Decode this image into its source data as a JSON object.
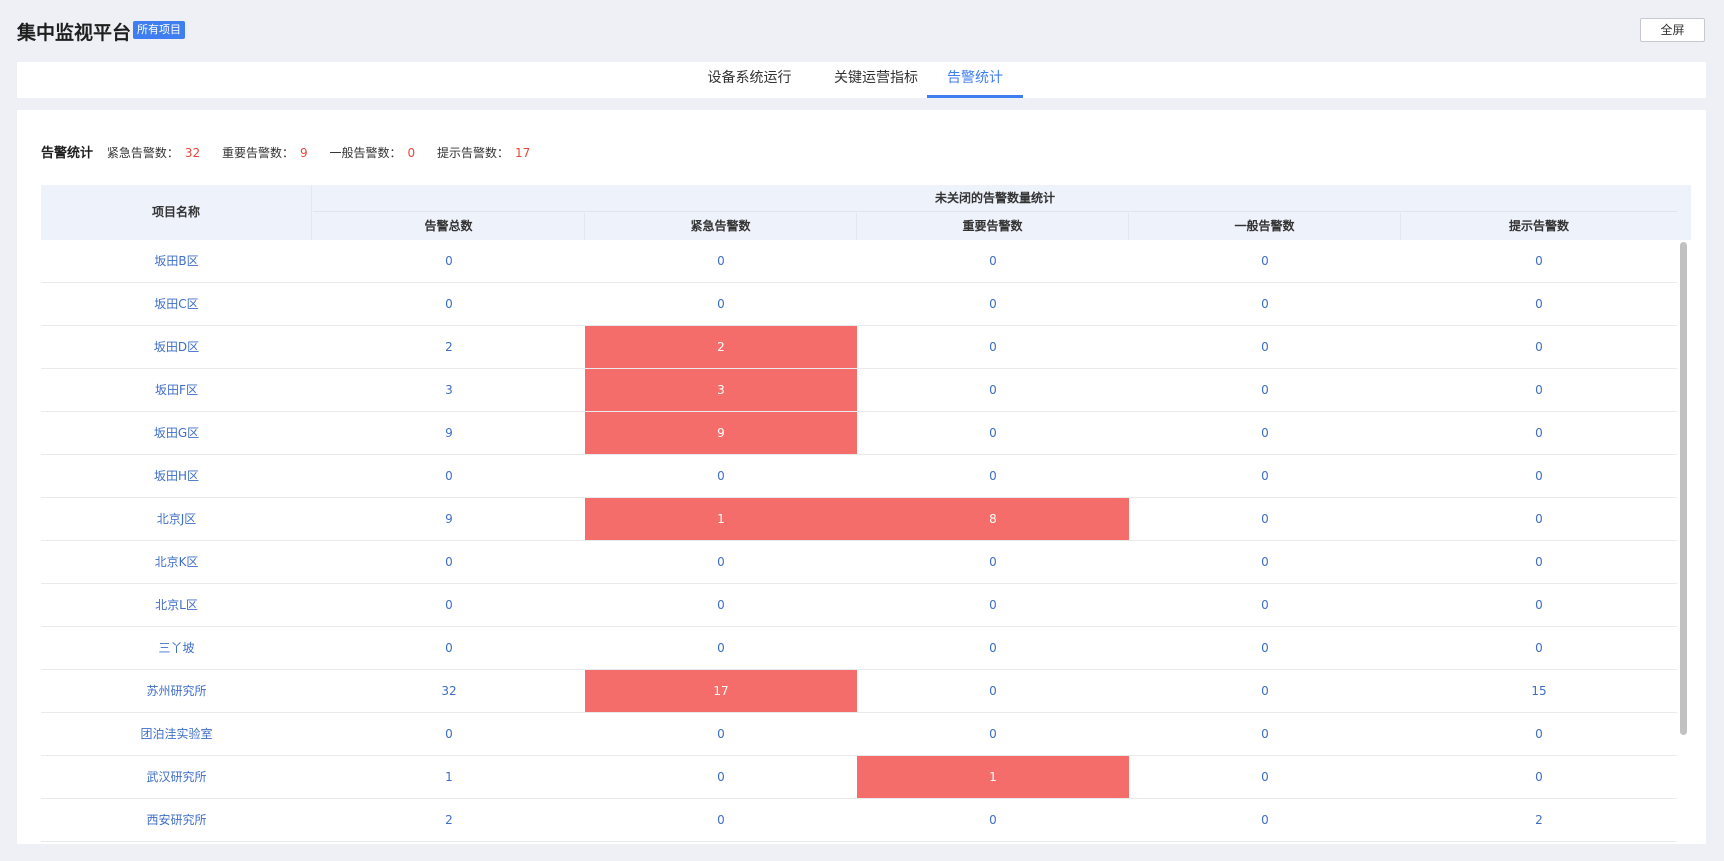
{
  "header": {
    "title": "集中监视平台",
    "project_badge": "所有项目",
    "fullscreen_label": "全屏"
  },
  "tabs": [
    {
      "label": "设备系统运行",
      "active": false
    },
    {
      "label": "关键运营指标",
      "active": false
    },
    {
      "label": "告警统计",
      "active": true
    }
  ],
  "summary": {
    "title": "告警统计",
    "items": [
      {
        "label": "紧急告警数：",
        "value": "32"
      },
      {
        "label": "重要告警数：",
        "value": "9"
      },
      {
        "label": "一般告警数：",
        "value": "0"
      },
      {
        "label": "提示告警数：",
        "value": "17"
      }
    ]
  },
  "table": {
    "project_header": "项目名称",
    "group_header": "未关闭的告警数量统计",
    "columns": [
      "告警总数",
      "紧急告警数",
      "重要告警数",
      "一般告警数",
      "提示告警数"
    ],
    "rows": [
      {
        "name": "坂田B区",
        "cells": [
          "0",
          "0",
          "0",
          "0",
          "0"
        ]
      },
      {
        "name": "坂田C区",
        "cells": [
          "0",
          "0",
          "0",
          "0",
          "0"
        ]
      },
      {
        "name": "坂田D区",
        "cells": [
          "2",
          "2",
          "0",
          "0",
          "0"
        ]
      },
      {
        "name": "坂田F区",
        "cells": [
          "3",
          "3",
          "0",
          "0",
          "0"
        ]
      },
      {
        "name": "坂田G区",
        "cells": [
          "9",
          "9",
          "0",
          "0",
          "0"
        ]
      },
      {
        "name": "坂田H区",
        "cells": [
          "0",
          "0",
          "0",
          "0",
          "0"
        ]
      },
      {
        "name": "北京J区",
        "cells": [
          "9",
          "1",
          "8",
          "0",
          "0"
        ]
      },
      {
        "name": "北京K区",
        "cells": [
          "0",
          "0",
          "0",
          "0",
          "0"
        ]
      },
      {
        "name": "北京L区",
        "cells": [
          "0",
          "0",
          "0",
          "0",
          "0"
        ]
      },
      {
        "name": "三丫坡",
        "cells": [
          "0",
          "0",
          "0",
          "0",
          "0"
        ]
      },
      {
        "name": "苏州研究所",
        "cells": [
          "32",
          "17",
          "0",
          "0",
          "15"
        ]
      },
      {
        "name": "团泊洼实验室",
        "cells": [
          "0",
          "0",
          "0",
          "0",
          "0"
        ]
      },
      {
        "name": "武汉研究所",
        "cells": [
          "1",
          "0",
          "1",
          "0",
          "0"
        ]
      },
      {
        "name": "西安研究所",
        "cells": [
          "2",
          "0",
          "0",
          "0",
          "2"
        ]
      }
    ]
  },
  "colors": {
    "accent": "#3f7ef0",
    "alert_cell": "#f56d6a",
    "summary_value": "#e5473b",
    "link_text": "#3f6ec8"
  }
}
